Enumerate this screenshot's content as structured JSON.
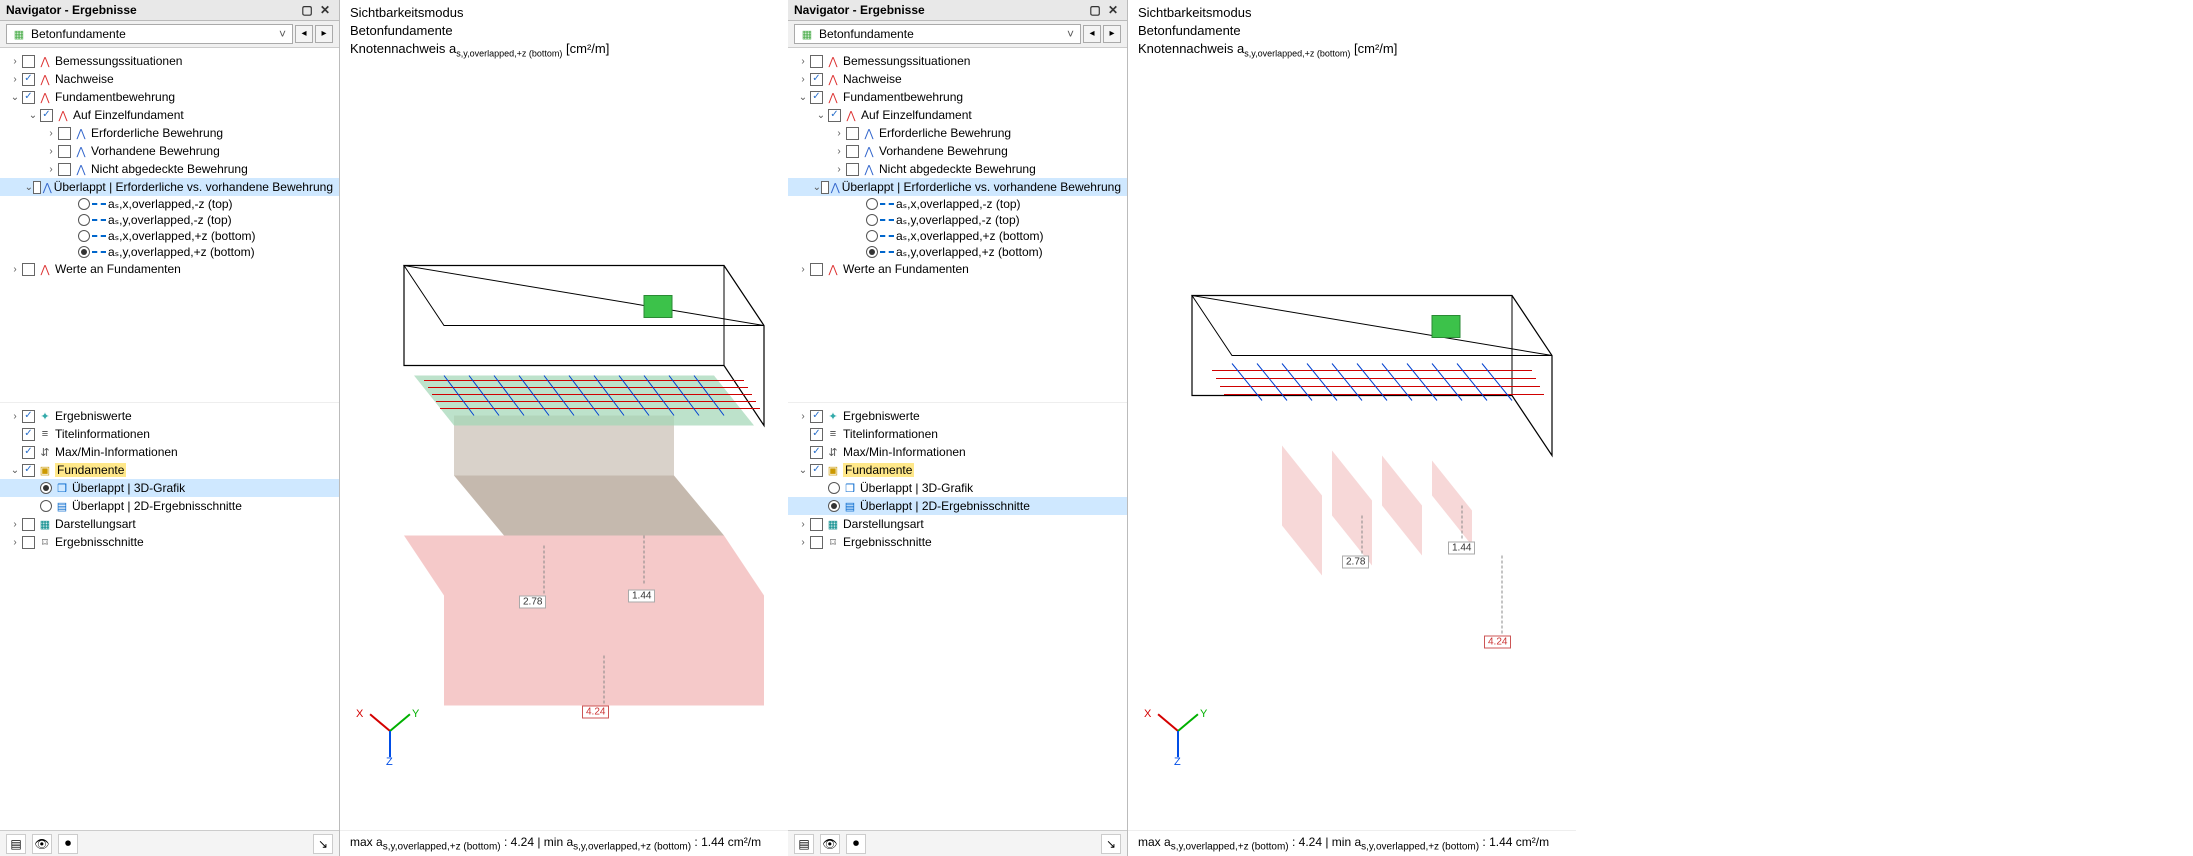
{
  "header": {
    "title": "Navigator - Ergebnisse"
  },
  "dropdown": {
    "label": "Betonfundamente"
  },
  "tree_top": {
    "bemessung": "Bemessungssituationen",
    "nachweise": "Nachweise",
    "fundb": "Fundamentbewehrung",
    "auf_einzel": "Auf Einzelfundament",
    "erforderlich": "Erforderliche Bewehrung",
    "vorhandene": "Vorhandene Bewehrung",
    "nicht_abged": "Nicht abgedeckte Bewehrung",
    "ueberlappt_long": "Überlappt | Erforderliche vs. vorhandene Bewehrung",
    "r_sx_top": "aₛ,x,overlapped,-z (top)",
    "r_sy_top": "aₛ,y,overlapped,-z (top)",
    "r_sx_bot": "aₛ,x,overlapped,+z (bottom)",
    "r_sy_bot": "aₛ,y,overlapped,+z (bottom)",
    "werte": "Werte an Fundamenten"
  },
  "tree_bottom": {
    "ergebniswerte": "Ergebniswerte",
    "titel": "Titelinformationen",
    "maxmin": "Max/Min-Informationen",
    "fundamente": "Fundamente",
    "u3d": "Überlappt | 3D-Grafik",
    "u2d": "Überlappt | 2D-Ergebnisschnitte",
    "darstellungsart": "Darstellungsart",
    "ergebnisschnitte": "Ergebnisschnitte"
  },
  "viewport_header": {
    "line1": "Sichtbarkeitsmodus",
    "line2": "Betonfundamente",
    "line3_pre": "Knotennachweis a",
    "line3_sub": "s,y,overlapped,+z (bottom)",
    "line3_unit": " [cm²/m]"
  },
  "footer": {
    "max_pre": "max a",
    "max_sub": "s,y,overlapped,+z (bottom)",
    "max_colon": " : ",
    "max_val": "4.24",
    "sep": " | ",
    "min_pre": "min a",
    "min_sub": "s,y,overlapped,+z (bottom)",
    "min_colon": " : ",
    "min_val": "1.44",
    "unit": " cm²/m"
  },
  "callouts": {
    "v278": "2.78",
    "v144": "1.44",
    "v424": "4.24"
  },
  "axes": {
    "x": "X",
    "y": "Y",
    "z": "Z"
  }
}
